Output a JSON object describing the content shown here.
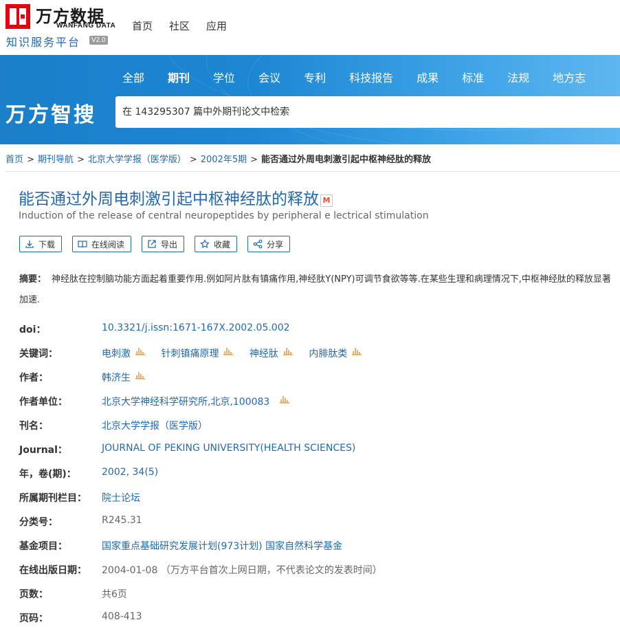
{
  "brand": {
    "name_cn": "万方数据",
    "name_en": "WANFANG DATA",
    "platform": "知识服务平台",
    "version": "V2.0"
  },
  "top_nav": [
    "首页",
    "社区",
    "应用"
  ],
  "categories": [
    "全部",
    "期刊",
    "学位",
    "会议",
    "专利",
    "科技报告",
    "成果",
    "标准",
    "法规",
    "地方志"
  ],
  "active_category": "期刊",
  "search": {
    "label": "万方智搜",
    "value": "在 143295307 篇中外期刊论文中检索"
  },
  "breadcrumb": [
    "首页",
    "期刊导航",
    "北京大学学报（医学版）",
    "2002年5期",
    "能否通过外周电刺激引起中枢神经肽的释放"
  ],
  "article": {
    "title": "能否通过外周电刺激引起中枢神经肽的释放",
    "title_badge": "M",
    "title_en": "Induction of the release of central neuropeptides by peripheral e lectrical stimulation"
  },
  "tools": [
    {
      "label": "下载",
      "icon": "download-icon"
    },
    {
      "label": "在线阅读",
      "icon": "book-icon"
    },
    {
      "label": "导出",
      "icon": "export-icon"
    },
    {
      "label": "收藏",
      "icon": "star-icon"
    },
    {
      "label": "分享",
      "icon": "share-icon"
    }
  ],
  "abstract": {
    "label": "摘要：",
    "text": "神经肽在控制脑功能方面起着重要作用.例如阿片肽有镇痛作用,神经肽Y(NPY)可调节食欲等等.在某些生理和病理情况下,中枢神经肽的释放显著加速."
  },
  "meta": {
    "doi": {
      "k": "doi：",
      "v": "10.3321/j.issn:1671-167X.2002.05.002"
    },
    "keywords": {
      "k": "关键词：",
      "items": [
        "电刺激",
        "针刺镇痛原理",
        "神经肽",
        "内腓肽类"
      ]
    },
    "author": {
      "k": "作者：",
      "v": "韩济生"
    },
    "affiliation": {
      "k": "作者单位：",
      "v": "北京大学神经科学研究所,北京,100083"
    },
    "journal_cn": {
      "k": "刊名：",
      "v": "北京大学学报（医学版）"
    },
    "journal_en": {
      "k": "Journal：",
      "v": "JOURNAL OF PEKING UNIVERSITY(HEALTH SCIENCES)"
    },
    "year_vol": {
      "k": "年，卷(期)：",
      "v": "2002, 34(5)"
    },
    "column": {
      "k": "所属期刊栏目：",
      "v": "院士论坛"
    },
    "class_no": {
      "k": "分类号：",
      "v": "R245.31"
    },
    "fund": {
      "k": "基金项目：",
      "v": "国家重点基础研究发展计划(973计划) 国家自然科学基金"
    },
    "online_date": {
      "k": "在线出版日期：",
      "v": "2004-01-08 （万方平台首次上网日期，不代表论文的发表时间）"
    },
    "pages": {
      "k": "页数：",
      "v": "共6页"
    },
    "page_range": {
      "k": "页码：",
      "v": "408-413"
    }
  },
  "colors": {
    "link": "#2169b3",
    "brand_red": "#e60012",
    "banner": "#1c86d2",
    "stat_icon": "#e6a04b"
  }
}
